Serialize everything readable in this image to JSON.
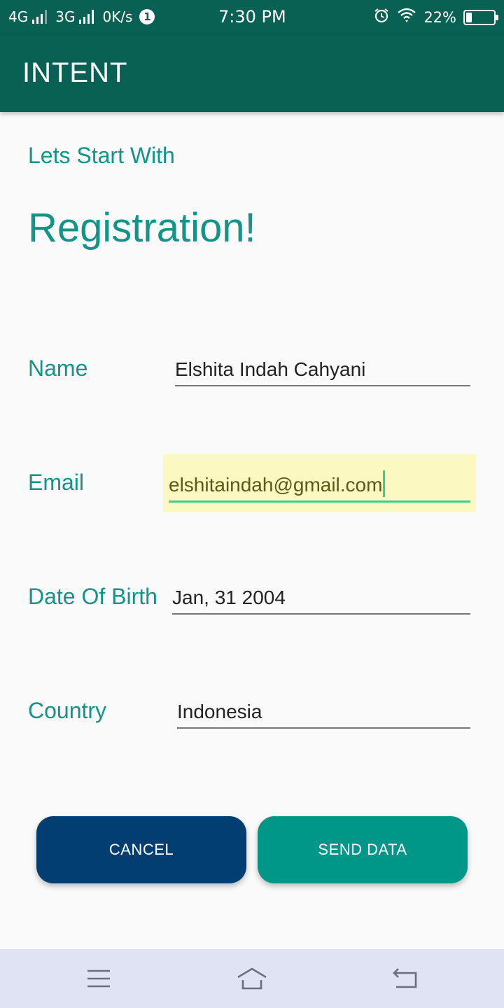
{
  "status_bar": {
    "network1": "4G",
    "network2": "3G",
    "speed": "0K/s",
    "notification_count": "1",
    "time": "7:30 PM",
    "battery_percent": "22%",
    "battery_level": 0.22,
    "icons": [
      "signal-icon",
      "alarm-icon",
      "wifi-icon",
      "battery-icon"
    ]
  },
  "app_bar": {
    "title": "INTENT",
    "color": "#086152"
  },
  "header": {
    "subtitle": "Lets Start With",
    "title": "Registration!"
  },
  "form": {
    "fields": [
      {
        "label": "Name",
        "value": "Elshita Indah Cahyani"
      },
      {
        "label": "Email",
        "value": "elshitaindah@gmail.com"
      },
      {
        "label": "Date Of Birth",
        "value": "Jan, 31 2004"
      },
      {
        "label": "Country",
        "value": "Indonesia"
      }
    ],
    "accent_color": "#129486"
  },
  "buttons": {
    "cancel": "CANCEL",
    "send": "SEND DATA",
    "cancel_color": "#033e73",
    "send_color": "#009788"
  },
  "nav_bar": {
    "icons": [
      "menu-icon",
      "home-icon",
      "back-icon"
    ]
  }
}
